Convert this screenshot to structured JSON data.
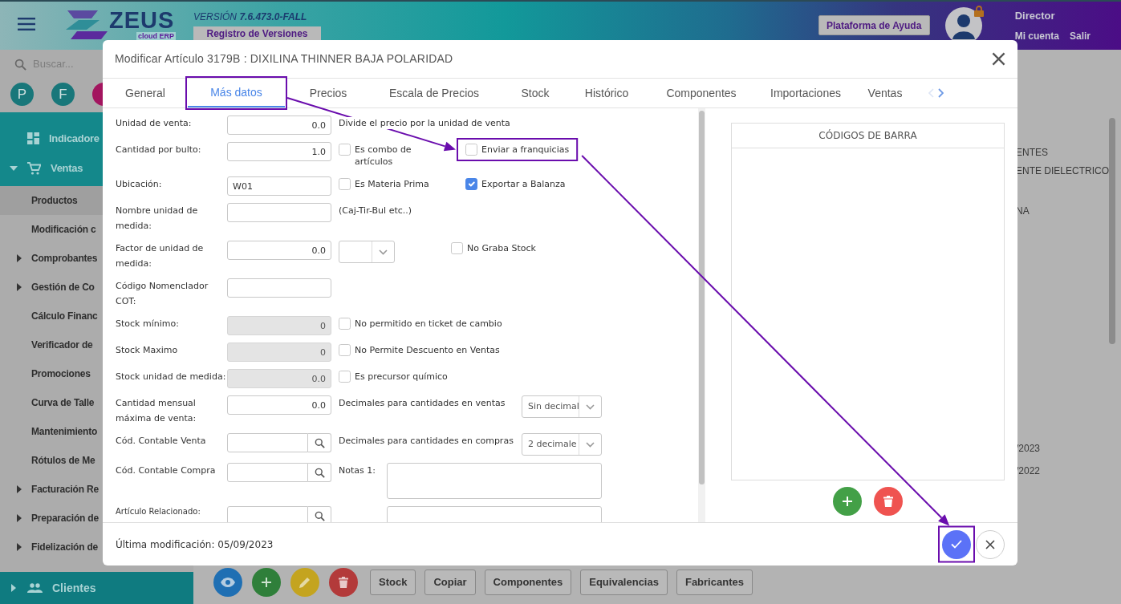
{
  "header": {
    "logo": {
      "name": "ZEUS",
      "tagline": "cloud ERP"
    },
    "version": "VERSIÓN **7.6.473.0-FALL**",
    "release_notes_button": "Registro de Versiones",
    "help_button": "Plataforma de Ayuda",
    "user": {
      "role": "Director",
      "links": [
        "Mi cuenta",
        "Salir"
      ]
    }
  },
  "sidebar": {
    "search": {
      "placeholder": "Buscar..."
    },
    "shortcuts": [
      {
        "label": "P",
        "color": "#18777a"
      },
      {
        "label": "F",
        "color": "#18777a"
      },
      {
        "color": "#a3155f"
      }
    ],
    "items": [
      {
        "label": "Indicadore",
        "kind": "section"
      },
      {
        "label": "Ventas",
        "kind": "section",
        "expanded": true,
        "children": [
          {
            "label": "Productos",
            "kind": "link",
            "selected": true
          },
          {
            "label": "Modificación c",
            "kind": "link",
            "selected": false
          },
          {
            "label": "Comprobantes",
            "kind": "group",
            "expanded": false,
            "selected": false
          },
          {
            "label": "Gestión de Co",
            "kind": "group",
            "expanded": false,
            "selected": false
          },
          {
            "label": "Cálculo Financ",
            "kind": "link",
            "selected": false
          },
          {
            "label": "Verificador de",
            "kind": "link",
            "selected": false
          },
          {
            "label": "Promociones",
            "kind": "link",
            "selected": false
          },
          {
            "label": "Curva de Talle",
            "kind": "link",
            "selected": false
          },
          {
            "label": "Mantenimiento",
            "kind": "link",
            "selected": false
          },
          {
            "label": "Rótulos de Me",
            "kind": "link",
            "selected": false
          },
          {
            "label": "Facturación Re",
            "kind": "group",
            "expanded": false,
            "selected": false
          },
          {
            "label": "Preparación de",
            "kind": "group",
            "expanded": false,
            "selected": false
          },
          {
            "label": "Fidelización de",
            "kind": "group",
            "expanded": false,
            "selected": false
          }
        ]
      },
      {
        "label": "Clientes",
        "kind": "section",
        "expanded": false
      }
    ]
  },
  "background": {
    "top_fragments": [
      "ENTES",
      "ENTE DIELECTRICO",
      "NA"
    ],
    "bottom_fragments": [
      "/2023",
      "/2022"
    ],
    "toolbar": {
      "buttons": [
        "Stock",
        "Copiar",
        "Componentes",
        "Equivalencias",
        "Fabricantes"
      ]
    }
  },
  "modal": {
    "title": "Modificar Artículo 3179B : DIXILINA THINNER BAJA POLARIDAD",
    "tabs": [
      {
        "label": "General",
        "selected": false,
        "highlighted": false
      },
      {
        "label": "Más datos",
        "selected": true,
        "highlighted": true
      },
      {
        "label": "Precios",
        "selected": false,
        "highlighted": false
      },
      {
        "label": "Escala de Precios",
        "selected": false,
        "highlighted": false
      },
      {
        "label": "Stock",
        "selected": false,
        "highlighted": false
      },
      {
        "label": "Histórico",
        "selected": false,
        "highlighted": false
      },
      {
        "label": "Componentes",
        "selected": false,
        "highlighted": false
      },
      {
        "label": "Importaciones",
        "selected": false,
        "highlighted": false
      },
      {
        "label": "Ventas",
        "selected": false,
        "highlighted": false
      }
    ],
    "form": {
      "rows": [
        {
          "label": "Unidad de venta:",
          "field": {
            "kind": "number",
            "value": "0.0",
            "disabled": false
          },
          "extras": [
            {
              "kind": "note",
              "text": "Divide el precio por la unidad de venta"
            }
          ]
        },
        {
          "label": "Cantidad por bulto:",
          "field": {
            "kind": "number",
            "value": "1.0",
            "disabled": false
          },
          "extras": [
            {
              "kind": "checkbox",
              "label": "Es combo de artículos",
              "checked": false,
              "highlighted": false
            },
            {
              "kind": "checkbox",
              "label": "Enviar a franquicias",
              "checked": false,
              "highlighted": true
            }
          ]
        },
        {
          "label": "Ubicación:",
          "field": {
            "kind": "text",
            "value": "W01",
            "disabled": false
          },
          "extras": [
            {
              "kind": "checkbox",
              "label": "Es Materia Prima",
              "checked": false,
              "highlighted": false
            },
            {
              "kind": "checkbox",
              "label": "Exportar a Balanza",
              "checked": true,
              "highlighted": false
            }
          ]
        },
        {
          "label": "Nombre unidad de medida:",
          "field": {
            "kind": "text",
            "disabled": false
          },
          "extras": [
            {
              "kind": "note",
              "text": "(Caj-Tir-Bul etc..)"
            }
          ]
        },
        {
          "label": "Factor de unidad de medida:",
          "field": {
            "kind": "number",
            "value": "0.0",
            "disabled": false
          },
          "extras": [
            {
              "kind": "select"
            },
            {
              "kind": "checkbox",
              "label": "No Graba Stock",
              "checked": false,
              "highlighted": false
            }
          ]
        },
        {
          "label": "Código Nomenclador COT:",
          "field": {
            "kind": "text",
            "disabled": false
          },
          "extras": []
        },
        {
          "label": "Stock mínimo:",
          "field": {
            "kind": "number",
            "value": "0",
            "disabled": true
          },
          "extras": [
            {
              "kind": "checkbox",
              "label": "No permitido en ticket de cambio",
              "checked": false,
              "highlighted": false
            }
          ]
        },
        {
          "label": "Stock Maximo",
          "field": {
            "kind": "number",
            "value": "0",
            "disabled": true
          },
          "extras": [
            {
              "kind": "checkbox",
              "label": "No Permite Descuento en Ventas",
              "checked": false,
              "highlighted": false
            }
          ]
        },
        {
          "label": "Stock unidad de medida:",
          "field": {
            "kind": "number",
            "value": "0.0",
            "disabled": true
          },
          "extras": [
            {
              "kind": "checkbox",
              "label": "Es precursor químico",
              "checked": false,
              "highlighted": false
            }
          ]
        },
        {
          "label": "Cantidad mensual máxima de venta:",
          "field": {
            "kind": "number",
            "value": "0.0",
            "disabled": false
          },
          "extras": [
            {
              "kind": "caption",
              "text": "Decimales para cantidades en ventas"
            },
            {
              "kind": "select",
              "value": "Sin decimal"
            }
          ]
        },
        {
          "label": "Cód. Contable Venta",
          "field": {
            "kind": "search",
            "disabled": false
          },
          "extras": [
            {
              "kind": "caption",
              "text": "Decimales para cantidades en compras"
            },
            {
              "kind": "select",
              "value": "2 decimale"
            }
          ]
        },
        {
          "label": "Cód. Contable Compra",
          "field": {
            "kind": "search",
            "disabled": false
          },
          "extras": [
            {
              "kind": "notes",
              "label": "Notas 1:"
            }
          ]
        },
        {
          "label": "Artículo Relacionado:",
          "compact": true,
          "field": {
            "kind": "search",
            "disabled": false
          },
          "extras": [
            {
              "kind": "notes"
            }
          ]
        }
      ]
    },
    "barcodes": {
      "title": "CÓDIGOS DE BARRA"
    },
    "footer": {
      "last_modified": "Última modificación: 05/09/2023",
      "confirm_highlighted": true
    }
  }
}
